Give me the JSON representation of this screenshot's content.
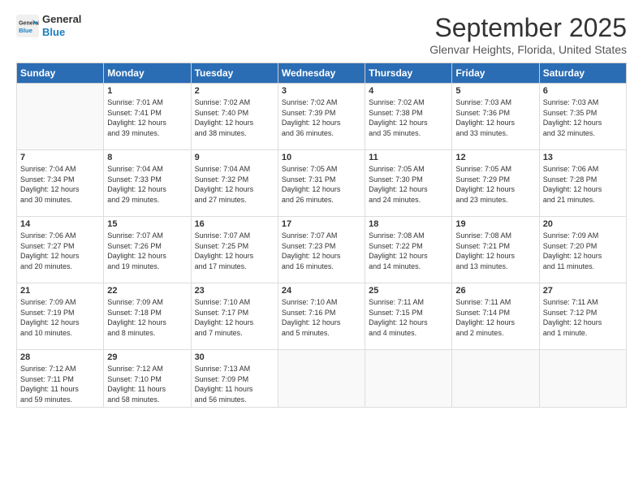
{
  "logo": {
    "line1": "General",
    "line2": "Blue"
  },
  "title": "September 2025",
  "subtitle": "Glenvar Heights, Florida, United States",
  "days_of_week": [
    "Sunday",
    "Monday",
    "Tuesday",
    "Wednesday",
    "Thursday",
    "Friday",
    "Saturday"
  ],
  "weeks": [
    [
      {
        "day": "",
        "info": ""
      },
      {
        "day": "1",
        "info": "Sunrise: 7:01 AM\nSunset: 7:41 PM\nDaylight: 12 hours\nand 39 minutes."
      },
      {
        "day": "2",
        "info": "Sunrise: 7:02 AM\nSunset: 7:40 PM\nDaylight: 12 hours\nand 38 minutes."
      },
      {
        "day": "3",
        "info": "Sunrise: 7:02 AM\nSunset: 7:39 PM\nDaylight: 12 hours\nand 36 minutes."
      },
      {
        "day": "4",
        "info": "Sunrise: 7:02 AM\nSunset: 7:38 PM\nDaylight: 12 hours\nand 35 minutes."
      },
      {
        "day": "5",
        "info": "Sunrise: 7:03 AM\nSunset: 7:36 PM\nDaylight: 12 hours\nand 33 minutes."
      },
      {
        "day": "6",
        "info": "Sunrise: 7:03 AM\nSunset: 7:35 PM\nDaylight: 12 hours\nand 32 minutes."
      }
    ],
    [
      {
        "day": "7",
        "info": "Sunrise: 7:04 AM\nSunset: 7:34 PM\nDaylight: 12 hours\nand 30 minutes."
      },
      {
        "day": "8",
        "info": "Sunrise: 7:04 AM\nSunset: 7:33 PM\nDaylight: 12 hours\nand 29 minutes."
      },
      {
        "day": "9",
        "info": "Sunrise: 7:04 AM\nSunset: 7:32 PM\nDaylight: 12 hours\nand 27 minutes."
      },
      {
        "day": "10",
        "info": "Sunrise: 7:05 AM\nSunset: 7:31 PM\nDaylight: 12 hours\nand 26 minutes."
      },
      {
        "day": "11",
        "info": "Sunrise: 7:05 AM\nSunset: 7:30 PM\nDaylight: 12 hours\nand 24 minutes."
      },
      {
        "day": "12",
        "info": "Sunrise: 7:05 AM\nSunset: 7:29 PM\nDaylight: 12 hours\nand 23 minutes."
      },
      {
        "day": "13",
        "info": "Sunrise: 7:06 AM\nSunset: 7:28 PM\nDaylight: 12 hours\nand 21 minutes."
      }
    ],
    [
      {
        "day": "14",
        "info": "Sunrise: 7:06 AM\nSunset: 7:27 PM\nDaylight: 12 hours\nand 20 minutes."
      },
      {
        "day": "15",
        "info": "Sunrise: 7:07 AM\nSunset: 7:26 PM\nDaylight: 12 hours\nand 19 minutes."
      },
      {
        "day": "16",
        "info": "Sunrise: 7:07 AM\nSunset: 7:25 PM\nDaylight: 12 hours\nand 17 minutes."
      },
      {
        "day": "17",
        "info": "Sunrise: 7:07 AM\nSunset: 7:23 PM\nDaylight: 12 hours\nand 16 minutes."
      },
      {
        "day": "18",
        "info": "Sunrise: 7:08 AM\nSunset: 7:22 PM\nDaylight: 12 hours\nand 14 minutes."
      },
      {
        "day": "19",
        "info": "Sunrise: 7:08 AM\nSunset: 7:21 PM\nDaylight: 12 hours\nand 13 minutes."
      },
      {
        "day": "20",
        "info": "Sunrise: 7:09 AM\nSunset: 7:20 PM\nDaylight: 12 hours\nand 11 minutes."
      }
    ],
    [
      {
        "day": "21",
        "info": "Sunrise: 7:09 AM\nSunset: 7:19 PM\nDaylight: 12 hours\nand 10 minutes."
      },
      {
        "day": "22",
        "info": "Sunrise: 7:09 AM\nSunset: 7:18 PM\nDaylight: 12 hours\nand 8 minutes."
      },
      {
        "day": "23",
        "info": "Sunrise: 7:10 AM\nSunset: 7:17 PM\nDaylight: 12 hours\nand 7 minutes."
      },
      {
        "day": "24",
        "info": "Sunrise: 7:10 AM\nSunset: 7:16 PM\nDaylight: 12 hours\nand 5 minutes."
      },
      {
        "day": "25",
        "info": "Sunrise: 7:11 AM\nSunset: 7:15 PM\nDaylight: 12 hours\nand 4 minutes."
      },
      {
        "day": "26",
        "info": "Sunrise: 7:11 AM\nSunset: 7:14 PM\nDaylight: 12 hours\nand 2 minutes."
      },
      {
        "day": "27",
        "info": "Sunrise: 7:11 AM\nSunset: 7:12 PM\nDaylight: 12 hours\nand 1 minute."
      }
    ],
    [
      {
        "day": "28",
        "info": "Sunrise: 7:12 AM\nSunset: 7:11 PM\nDaylight: 11 hours\nand 59 minutes."
      },
      {
        "day": "29",
        "info": "Sunrise: 7:12 AM\nSunset: 7:10 PM\nDaylight: 11 hours\nand 58 minutes."
      },
      {
        "day": "30",
        "info": "Sunrise: 7:13 AM\nSunset: 7:09 PM\nDaylight: 11 hours\nand 56 minutes."
      },
      {
        "day": "",
        "info": ""
      },
      {
        "day": "",
        "info": ""
      },
      {
        "day": "",
        "info": ""
      },
      {
        "day": "",
        "info": ""
      }
    ]
  ]
}
